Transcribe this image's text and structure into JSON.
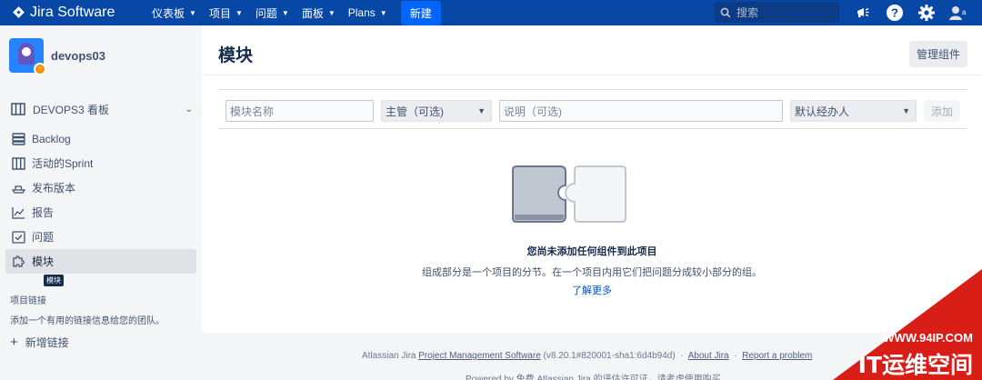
{
  "topnav": {
    "app_name": "Jira Software",
    "menus": [
      {
        "label": "仪表板"
      },
      {
        "label": "项目"
      },
      {
        "label": "问题"
      },
      {
        "label": "面板"
      },
      {
        "label": "Plans"
      }
    ],
    "create_label": "新建",
    "search_placeholder": "搜索",
    "icons": [
      "megaphone-icon",
      "help-icon",
      "gear-icon",
      "avatar"
    ],
    "brand_color": "#0747a6"
  },
  "sidebar": {
    "project_name": "devops03",
    "board_label": "DEVOPS3 看板",
    "items": [
      {
        "label": "Backlog",
        "icon": "backlog-icon"
      },
      {
        "label": "活动的Sprint",
        "icon": "board-icon"
      },
      {
        "label": "发布版本",
        "icon": "ship-icon"
      },
      {
        "label": "报告",
        "icon": "chart-icon"
      },
      {
        "label": "问题",
        "icon": "issues-icon"
      },
      {
        "label": "模块",
        "icon": "puzzle-icon",
        "active": true
      }
    ],
    "tooltip": "模块",
    "project_links_heading": "项目链接",
    "project_links_desc": "添加一个有用的链接信息给您的团队。",
    "add_link_label": "新增链接"
  },
  "main": {
    "title": "模块",
    "manage_button": "管理组件",
    "form": {
      "name_placeholder": "模块名称",
      "lead_select": "主管（可选)",
      "desc_placeholder": "说明（可选)",
      "assignee_select": "默认经办人",
      "add_button": "添加"
    },
    "empty": {
      "title": "您尚未添加任何组件到此项目",
      "description": "组成部分是一个项目的分节。在一个项目内用它们把问题分成较小部分的组。",
      "learn_more": "了解更多"
    }
  },
  "footer": {
    "prefix": "Atlassian Jira",
    "pm_link": "Project Management Software",
    "version": "(v8.20.1#820001-sha1:6d4b94d)",
    "sep": "·",
    "about": "About Jira",
    "report": "Report a problem",
    "line2": "Powered by 免费 Atlassian Jira 的评估许可证。请考虑使用购买"
  },
  "watermark": {
    "url": "WWW.94IP.COM",
    "text": "IT运维空间"
  }
}
